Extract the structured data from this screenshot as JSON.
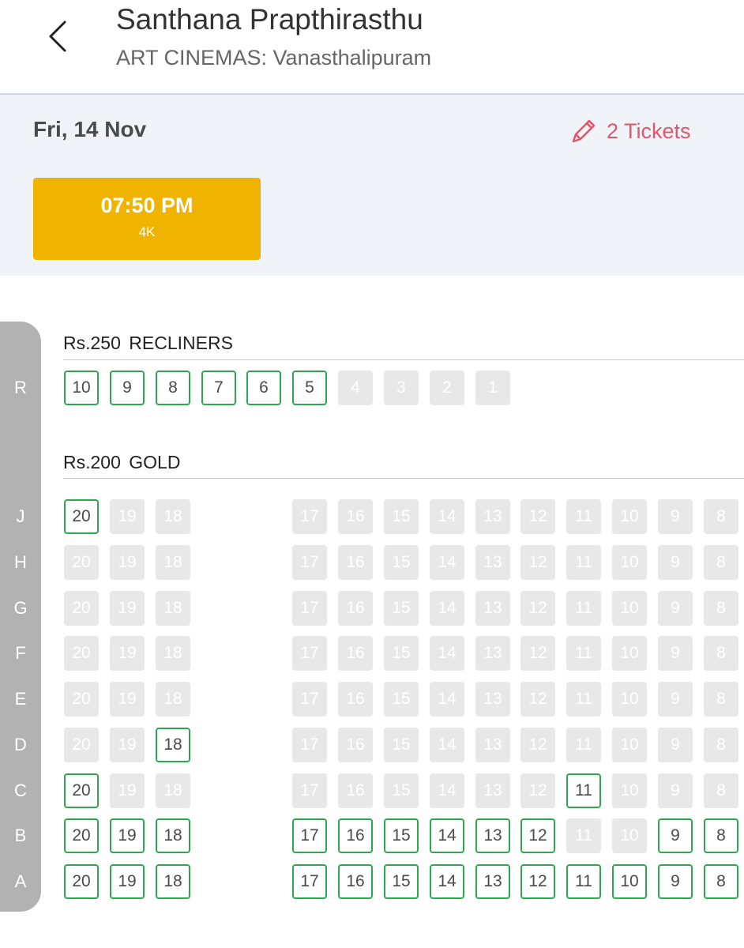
{
  "header": {
    "title": "Santhana Prapthirasthu",
    "subtitle": "ART CINEMAS: Vanasthalipuram",
    "back_icon": "chevron-left-icon"
  },
  "booking": {
    "date": "Fri, 14 Nov",
    "tickets_label": "2 Tickets",
    "tickets_icon": "pencil-icon",
    "accent_color": "#e3566a"
  },
  "showtime": {
    "time": "07:50 PM",
    "format": "4K",
    "color": "#f0b400"
  },
  "legend_colors": {
    "available_border": "#2ea84f",
    "sold_fill": "#e8e8e8"
  },
  "sections": [
    {
      "title": "Rs.250  RECLINERS",
      "rows": [
        {
          "label": "R",
          "seats": [
            {
              "num": "10",
              "status": "available"
            },
            {
              "num": "9",
              "status": "available"
            },
            {
              "num": "8",
              "status": "available"
            },
            {
              "num": "7",
              "status": "available"
            },
            {
              "num": "6",
              "status": "available"
            },
            {
              "num": "5",
              "status": "available"
            },
            {
              "num": "4",
              "status": "sold"
            },
            {
              "num": "3",
              "status": "sold"
            },
            {
              "num": "2",
              "status": "sold"
            },
            {
              "num": "1",
              "status": "sold"
            }
          ]
        }
      ]
    },
    {
      "title": "Rs.200  GOLD",
      "rows": [
        {
          "label": "J",
          "available": [
            "20"
          ]
        },
        {
          "label": "H",
          "available": []
        },
        {
          "label": "G",
          "available": []
        },
        {
          "label": "F",
          "available": []
        },
        {
          "label": "E",
          "available": []
        },
        {
          "label": "D",
          "available": [
            "18"
          ]
        },
        {
          "label": "C",
          "available": [
            "20",
            "11"
          ]
        },
        {
          "label": "B",
          "available": [
            "20",
            "19",
            "18",
            "17",
            "16",
            "15",
            "14",
            "13",
            "12",
            "9",
            "8"
          ]
        },
        {
          "label": "A",
          "available": [
            "20",
            "19",
            "18",
            "17",
            "16",
            "15",
            "14",
            "13",
            "12",
            "11",
            "10",
            "9",
            "8"
          ]
        }
      ],
      "seat_numbers": [
        "20",
        "19",
        "18",
        "17",
        "16",
        "15",
        "14",
        "13",
        "12",
        "11",
        "10",
        "9",
        "8"
      ]
    }
  ]
}
